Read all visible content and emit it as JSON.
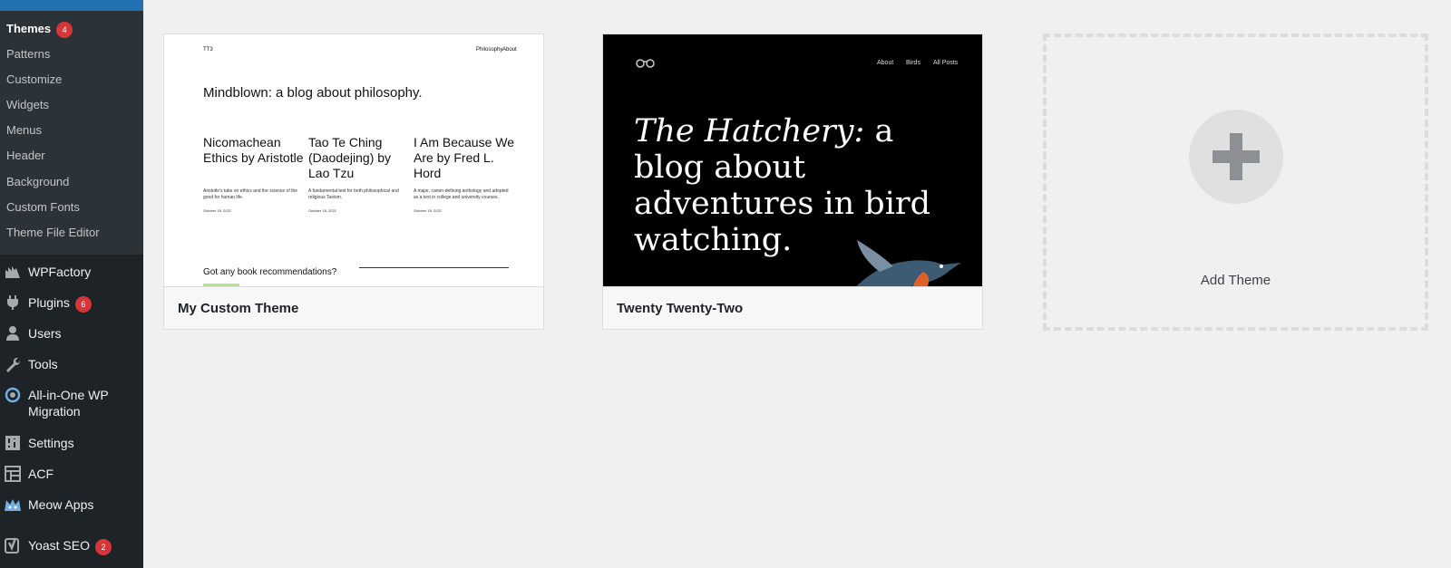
{
  "sidebar": {
    "submenu": [
      {
        "label": "Themes",
        "badge": "4"
      },
      {
        "label": "Patterns"
      },
      {
        "label": "Customize"
      },
      {
        "label": "Widgets"
      },
      {
        "label": "Menus"
      },
      {
        "label": "Header"
      },
      {
        "label": "Background"
      },
      {
        "label": "Custom Fonts"
      },
      {
        "label": "Theme File Editor"
      }
    ],
    "menu": [
      {
        "label": "WPFactory",
        "icon": "wpfactory-icon"
      },
      {
        "label": "Plugins",
        "icon": "plugins-icon",
        "badge": "6"
      },
      {
        "label": "Users",
        "icon": "users-icon"
      },
      {
        "label": "Tools",
        "icon": "tools-icon"
      },
      {
        "label": "All-in-One WP",
        "label2": "Migration",
        "icon": "migration-icon"
      },
      {
        "label": "Settings",
        "icon": "settings-icon"
      },
      {
        "label": "ACF",
        "icon": "acf-icon"
      },
      {
        "label": "Meow Apps",
        "icon": "meow-icon"
      },
      {
        "label": "Yoast SEO",
        "icon": "yoast-icon",
        "badge": "2"
      }
    ]
  },
  "themes": [
    {
      "name": "My Custom Theme",
      "preview": {
        "logo": "TT3",
        "nav": [
          "Philosophy",
          "About"
        ],
        "heading": "Mindblown: a blog about philosophy.",
        "posts": [
          {
            "title": "Nicomachean Ethics by Aristotle",
            "excerpt": "Aristotle's take on ethics and the science of the good for human life.",
            "date": "October 18, 2022"
          },
          {
            "title": "Tao Te Ching (Daodejing) by Lao Tzu",
            "excerpt": "A fundamental text for both philosophical and religious Taoism.",
            "date": "October 18, 2022"
          },
          {
            "title": "I Am Because We Are by Fred L. Hord",
            "excerpt": "A major, canon-defining anthology and adopted as a text in college and university courses.",
            "date": "October 18, 2022"
          }
        ],
        "cta": "Got any book recommendations?"
      }
    },
    {
      "name": "Twenty Twenty-Two",
      "preview": {
        "nav": [
          "About",
          "Birds",
          "All Posts"
        ],
        "headline_italic": "The Hatchery:",
        "headline_rest": " a blog about adventures in bird watching."
      }
    }
  ],
  "add_theme": {
    "label": "Add Theme"
  },
  "colors": {
    "sidebar_bg": "#1d2327",
    "submenu_bg": "#2c3338",
    "accent": "#2271b1",
    "badge": "#d63638",
    "page_bg": "#f0f0f1"
  }
}
